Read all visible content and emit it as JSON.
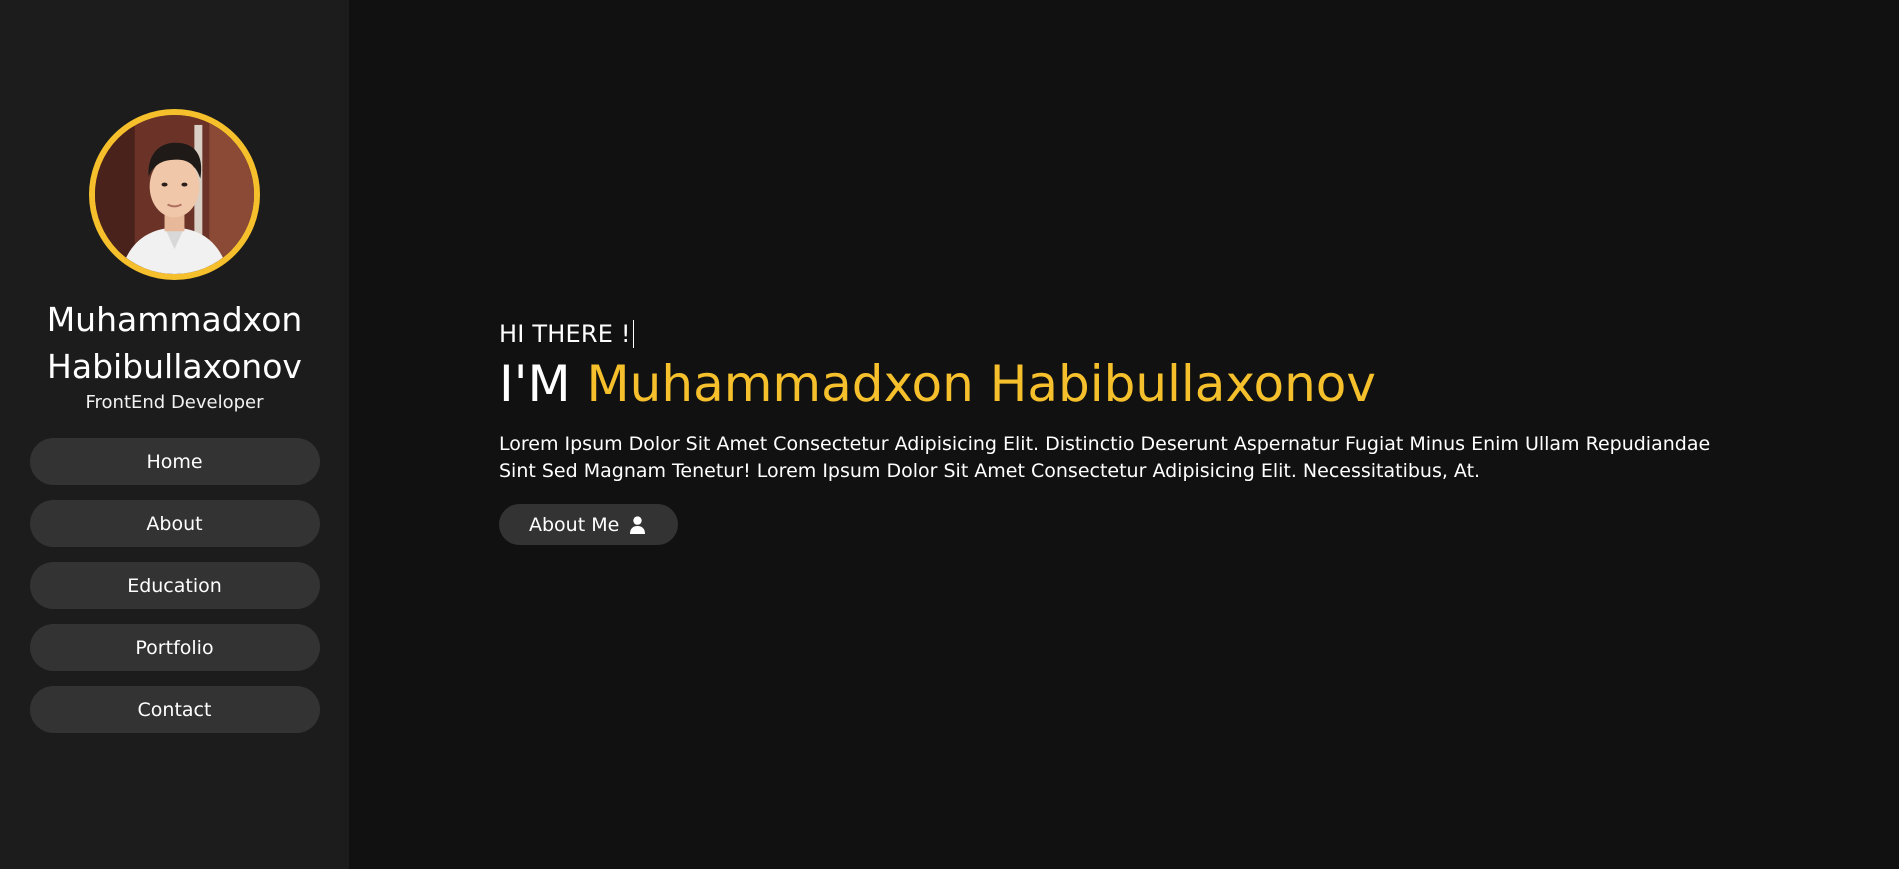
{
  "sidebar": {
    "name": "Muhammadxon Habibullaxonov",
    "role": "FrontEnd Developer",
    "nav": [
      {
        "label": "Home"
      },
      {
        "label": "About"
      },
      {
        "label": "Education"
      },
      {
        "label": "Portfolio"
      },
      {
        "label": "Contact"
      }
    ]
  },
  "hero": {
    "greeting": "HI THERE !",
    "headline_prefix": "I'M",
    "headline_name": "Muhammadxon Habibullaxonov",
    "description": "Lorem Ipsum Dolor Sit Amet Consectetur Adipisicing Elit. Distinctio Deserunt Aspernatur Fugiat Minus Enim Ullam Repudiandae Sint Sed Magnam Tenetur! Lorem Ipsum Dolor Sit Amet Consectetur Adipisicing Elit. Necessitatibus, At.",
    "about_button_label": "About Me",
    "about_button_icon": "user-icon"
  },
  "colors": {
    "accent": "#f5c02b",
    "background": "#111111",
    "sidebar_background": "#1c1c1c",
    "button_background": "#333333"
  }
}
